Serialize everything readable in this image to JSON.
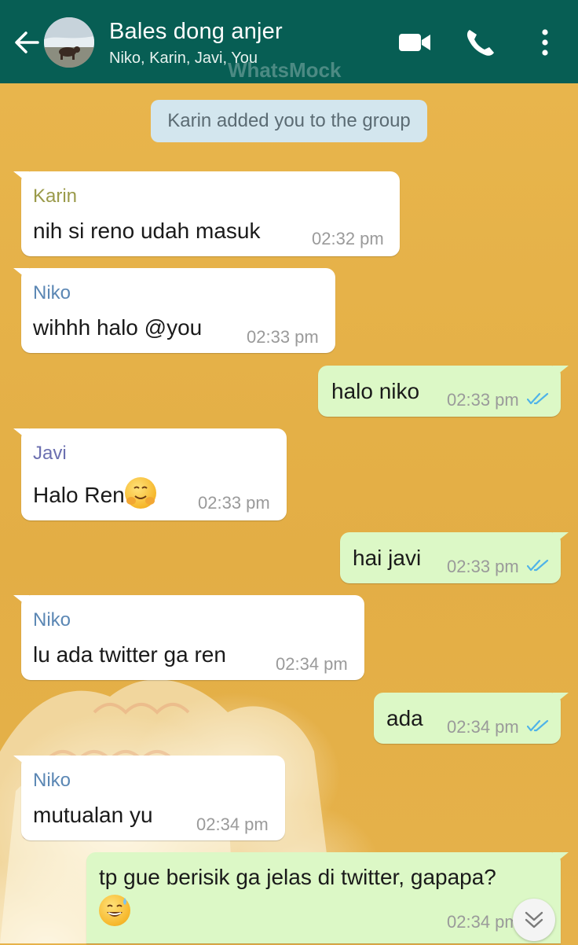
{
  "header": {
    "title": "Bales dong anjer",
    "subtitle": "Niko, Karin, Javi, You",
    "watermark": "WhatsMock",
    "icons": [
      "back-arrow-icon",
      "group-avatar",
      "video-call-icon",
      "phone-call-icon",
      "more-options-icon"
    ]
  },
  "colors": {
    "header_bg": "#075e54",
    "incoming_bubble": "#ffffff",
    "outgoing_bubble": "#dcf8c6",
    "system_bubble": "#d3e6ee",
    "read_ticks": "#4fb3e8",
    "sender_karin": "#9a9a4a",
    "sender_niko": "#5b87b4",
    "sender_javi": "#6b6fb0"
  },
  "system_message": "Karin added you to the group",
  "messages": [
    {
      "direction": "in",
      "sender": "Karin",
      "text": "nih si reno udah masuk",
      "time": "02:32 pm"
    },
    {
      "direction": "in",
      "sender": "Niko",
      "text": "wihhh halo @you",
      "time": "02:33 pm"
    },
    {
      "direction": "out",
      "text": "halo niko",
      "time": "02:33 pm",
      "status": "read"
    },
    {
      "direction": "in",
      "sender": "Javi",
      "text": "Halo Ren",
      "emoji": "hugging-face-emoji",
      "time": "02:33 pm"
    },
    {
      "direction": "out",
      "text": "hai javi",
      "time": "02:33 pm",
      "status": "read"
    },
    {
      "direction": "in",
      "sender": "Niko",
      "text": "lu ada twitter ga ren",
      "time": "02:34 pm"
    },
    {
      "direction": "out",
      "text": "ada",
      "time": "02:34 pm",
      "status": "read"
    },
    {
      "direction": "in",
      "sender": "Niko",
      "text": "mutualan yu",
      "time": "02:34 pm"
    },
    {
      "direction": "out",
      "text": "tp gue berisik ga jelas di twitter, gapapa?",
      "emoji": "grinning-face-with-sweat-emoji",
      "time": "02:34 pm",
      "status": "read"
    }
  ],
  "scroll_button": "chevron-double-down-icon"
}
